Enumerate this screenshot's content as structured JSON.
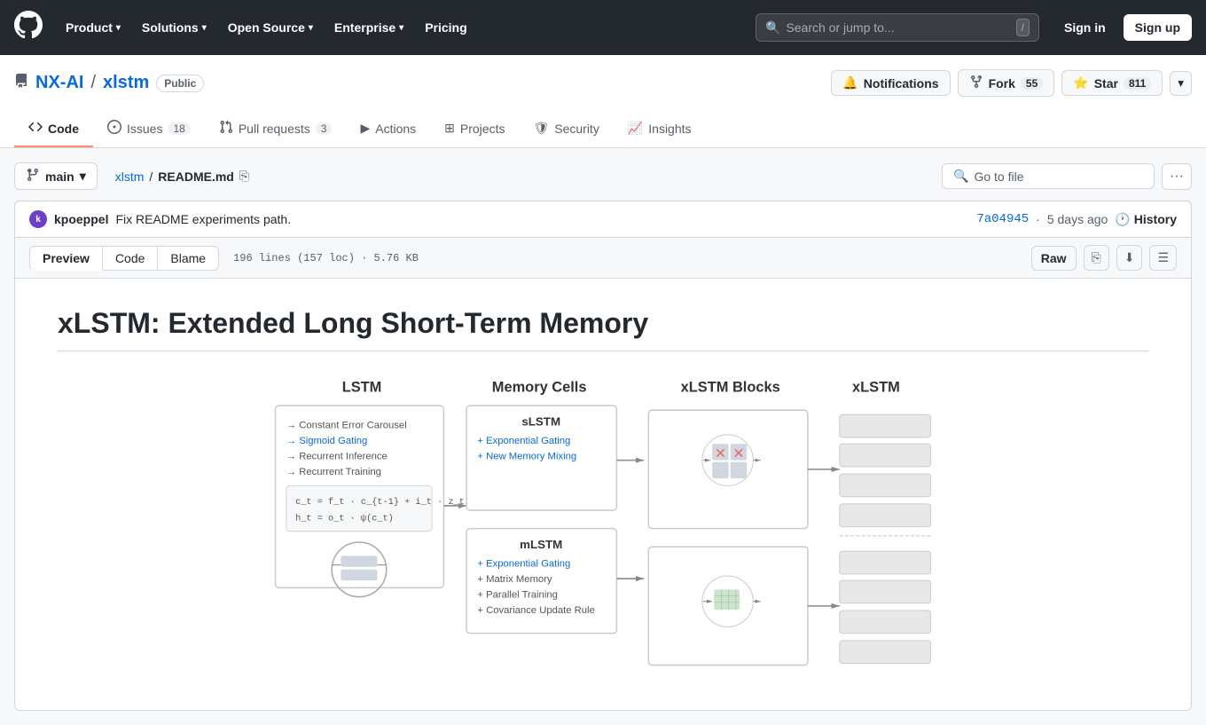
{
  "topnav": {
    "logo": "⬤",
    "items": [
      {
        "label": "Product",
        "has_dropdown": true
      },
      {
        "label": "Solutions",
        "has_dropdown": true
      },
      {
        "label": "Open Source",
        "has_dropdown": true
      },
      {
        "label": "Enterprise",
        "has_dropdown": true
      },
      {
        "label": "Pricing",
        "has_dropdown": false
      }
    ],
    "search_placeholder": "Search or jump to...",
    "shortcut": "/",
    "signin_label": "Sign in",
    "signup_label": "Sign up"
  },
  "repo": {
    "owner": "NX-AI",
    "name": "xlstm",
    "visibility": "Public",
    "tabs": [
      {
        "label": "Code",
        "icon": "code",
        "badge": null,
        "active": false
      },
      {
        "label": "Issues",
        "icon": "issue",
        "badge": "18",
        "active": false
      },
      {
        "label": "Pull requests",
        "icon": "pr",
        "badge": "3",
        "active": false
      },
      {
        "label": "Actions",
        "icon": "actions",
        "badge": null,
        "active": false
      },
      {
        "label": "Projects",
        "icon": "projects",
        "badge": null,
        "active": false
      },
      {
        "label": "Security",
        "icon": "security",
        "badge": null,
        "active": false
      },
      {
        "label": "Insights",
        "icon": "insights",
        "badge": null,
        "active": false
      }
    ],
    "notifications_label": "Notifications",
    "fork_label": "Fork",
    "fork_count": "55",
    "star_label": "Star",
    "star_count": "811"
  },
  "file_view": {
    "branch": "main",
    "path_parts": [
      "xlstm",
      "README.md"
    ],
    "goto_placeholder": "Go to file",
    "commit_author": "kpoeppel",
    "commit_msg": "Fix README experiments path.",
    "commit_sha": "7a04945",
    "commit_time": "5 days ago",
    "history_label": "History",
    "file_meta": "196 lines (157 loc) · 5.76 KB",
    "view_tabs": [
      {
        "label": "Preview",
        "active": true
      },
      {
        "label": "Code",
        "active": false
      },
      {
        "label": "Blame",
        "active": false
      }
    ],
    "raw_label": "Raw",
    "readme_title": "xLSTM: Extended Long Short-Term Memory",
    "diagram": {
      "columns": [
        "LSTM",
        "Memory Cells",
        "xLSTM Blocks",
        "xLSTM"
      ],
      "slstm_features": [
        "+ Exponential Gating",
        "+ New Memory Mixing"
      ],
      "mlstm_features": [
        "+ Exponential Gating",
        "+ Matrix Memory",
        "+ Parallel Training",
        "+ Covariance Update Rule"
      ],
      "lstm_features": [
        "→ Constant Error Carousel",
        "→ Sigmoid Gating",
        "→ Recurrent Inference",
        "→ Recurrent Training"
      ]
    }
  }
}
